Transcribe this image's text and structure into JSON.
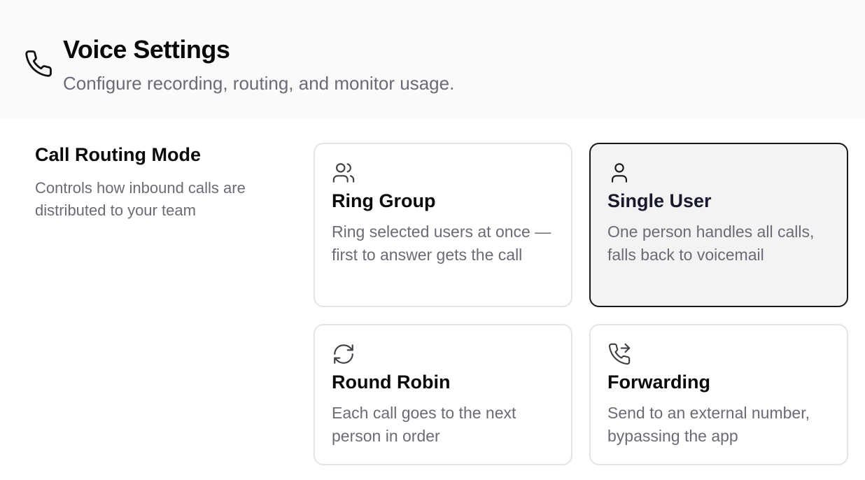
{
  "header": {
    "icon": "phone-icon",
    "title": "Voice Settings",
    "subtitle": "Configure recording, routing, and monitor usage."
  },
  "routing": {
    "title": "Call Routing Mode",
    "description": "Controls how inbound calls are distributed to your team",
    "selected": "Single User",
    "options": [
      {
        "icon": "users-icon",
        "title": "Ring Group",
        "description": "Ring selected users at once — first to answer gets the call"
      },
      {
        "icon": "user-icon",
        "title": "Single User",
        "description": "One person handles all calls, falls back to voicemail"
      },
      {
        "icon": "refresh-icon",
        "title": "Round Robin",
        "description": "Each call goes to the next person in order"
      },
      {
        "icon": "phone-forward-icon",
        "title": "Forwarding",
        "description": "Send to an external number, bypassing the app"
      }
    ]
  },
  "colors": {
    "header_bg": "#fafafa",
    "border": "#e4e4e7",
    "selected_border": "#18181b",
    "selected_bg": "#f3f3f3",
    "muted_text": "#6b6b76"
  }
}
